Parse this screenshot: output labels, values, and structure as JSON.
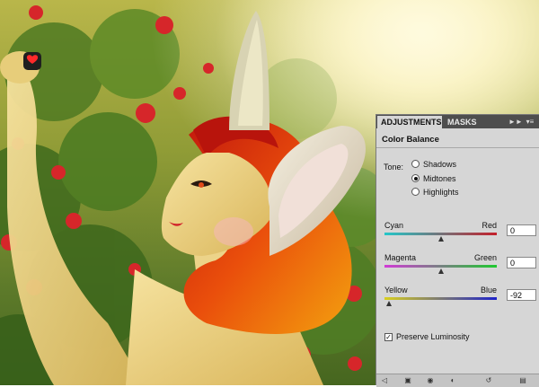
{
  "panel": {
    "tabs": [
      {
        "label": "ADJUSTMENTS",
        "active": true
      },
      {
        "label": "MASKS",
        "active": false
      }
    ],
    "tab_arrows_icon": "double-chevron-right-icon",
    "panel_menu_icon": "panel-menu-icon",
    "title": "Color Balance",
    "tone": {
      "label": "Tone:",
      "options": [
        "Shadows",
        "Midtones",
        "Highlights"
      ],
      "selected": "Midtones"
    },
    "sliders": [
      {
        "left_label": "Cyan",
        "right_label": "Red",
        "value": "0",
        "min": -100,
        "max": 100,
        "colors": [
          "#23c7c9",
          "#c41f2a"
        ]
      },
      {
        "left_label": "Magenta",
        "right_label": "Green",
        "value": "0",
        "min": -100,
        "max": 100,
        "colors": [
          "#d13ad6",
          "#1fc92f"
        ]
      },
      {
        "left_label": "Yellow",
        "right_label": "Blue",
        "value": "-92",
        "min": -100,
        "max": 100,
        "colors": [
          "#d8cf1f",
          "#1d22c9"
        ]
      }
    ],
    "preserve_luminosity": {
      "label": "Preserve Luminosity",
      "checked": true
    },
    "bottom_icons": [
      "return-arrow-icon",
      "clip-layer-icon",
      "visibility-eye-icon",
      "view-previous-icon",
      "reset-icon",
      "trash-icon"
    ]
  },
  "colors": {
    "panel_bg": "#d6d6d6",
    "tabbar_bg": "#4e4e4e"
  }
}
